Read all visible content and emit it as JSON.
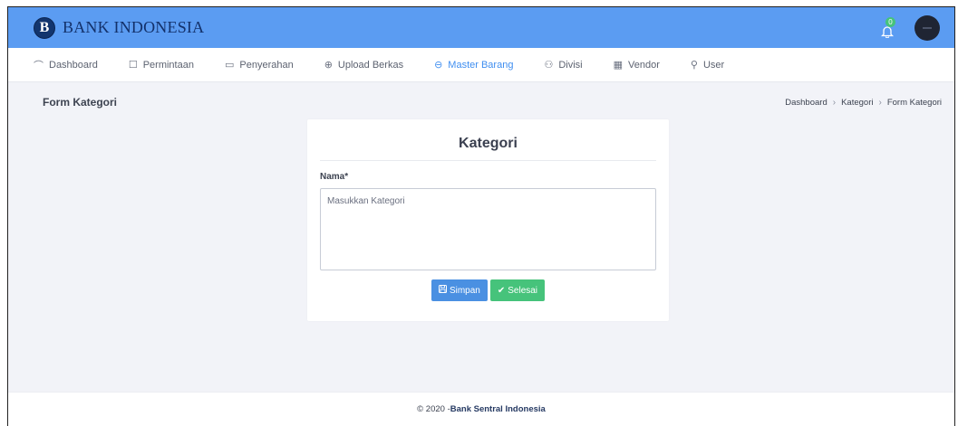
{
  "brand": {
    "logo_letter": "B",
    "name": "BANK INDONESIA"
  },
  "topbar": {
    "notification_count": "0"
  },
  "nav": [
    {
      "icon": "⌒",
      "label": "Dashboard"
    },
    {
      "icon": "☐",
      "label": "Permintaan"
    },
    {
      "icon": "▭",
      "label": "Penyerahan"
    },
    {
      "icon": "⊕",
      "label": "Upload Berkas"
    },
    {
      "icon": "⊖",
      "label": "Master Barang"
    },
    {
      "icon": "⚇",
      "label": "Divisi"
    },
    {
      "icon": "▦",
      "label": "Vendor"
    },
    {
      "icon": "⚲",
      "label": "User"
    }
  ],
  "page": {
    "title": "Form Kategori"
  },
  "breadcrumb": [
    "Dashboard",
    "Kategori",
    "Form Kategori"
  ],
  "form": {
    "title": "Kategori",
    "field_label": "Nama*",
    "placeholder": "Masukkan Kategori",
    "value": "",
    "save_label": "Simpan",
    "done_label": "Selesai"
  },
  "footer": {
    "prefix": "© 2020 - ",
    "name": "Bank Sentral Indonesia"
  },
  "colors": {
    "topbar": "#5b9cf2",
    "active_nav": "#3f8ef0",
    "primary": "#4a90e2",
    "success": "#46c37b"
  }
}
